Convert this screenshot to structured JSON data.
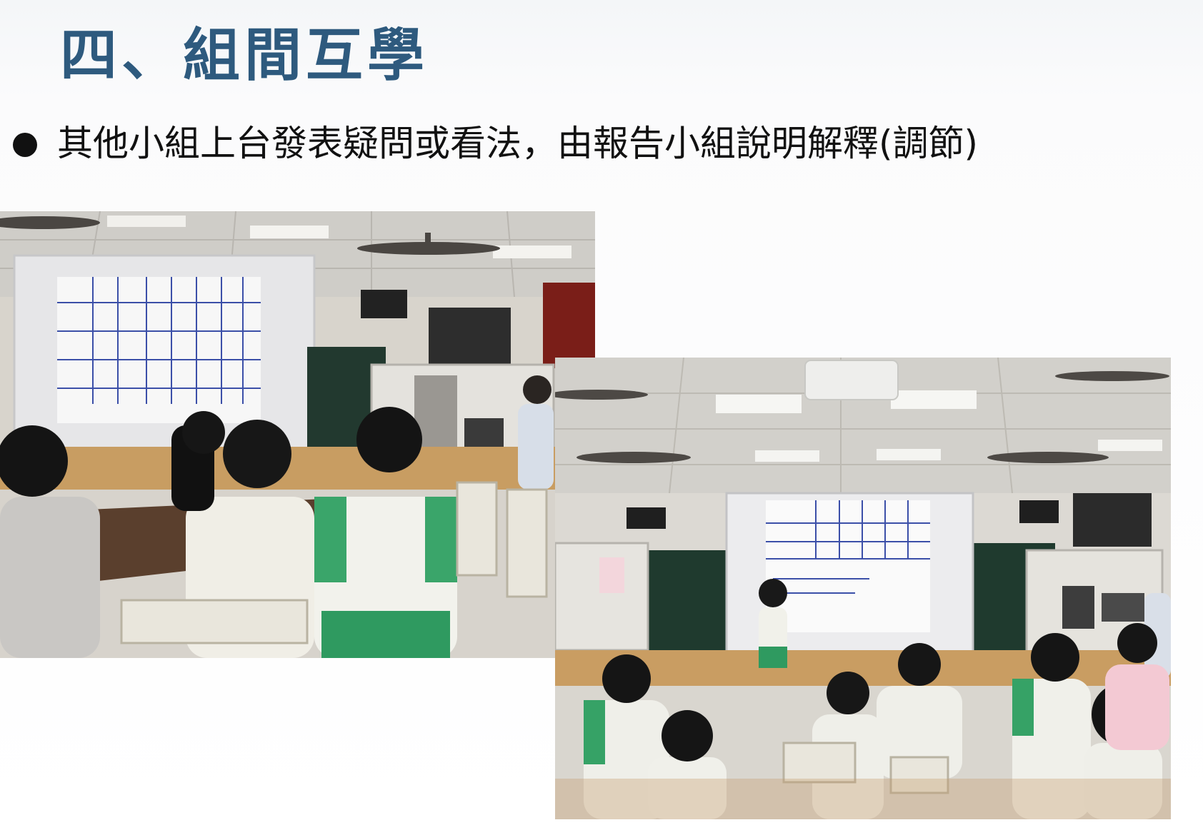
{
  "slide": {
    "title": "四、組間互學",
    "bullets": [
      {
        "text": "其他小組上台發表疑問或看法，由報告小組說明解釋(調節)"
      }
    ]
  },
  "colors": {
    "title": "#2e5a7e",
    "bullet_text": "#111111",
    "bullet_dot": "#111111",
    "background": "#ffffff"
  },
  "photos": [
    {
      "name": "classroom-photo-left",
      "description_icon": "photo"
    },
    {
      "name": "classroom-photo-right",
      "description_icon": "photo"
    }
  ]
}
